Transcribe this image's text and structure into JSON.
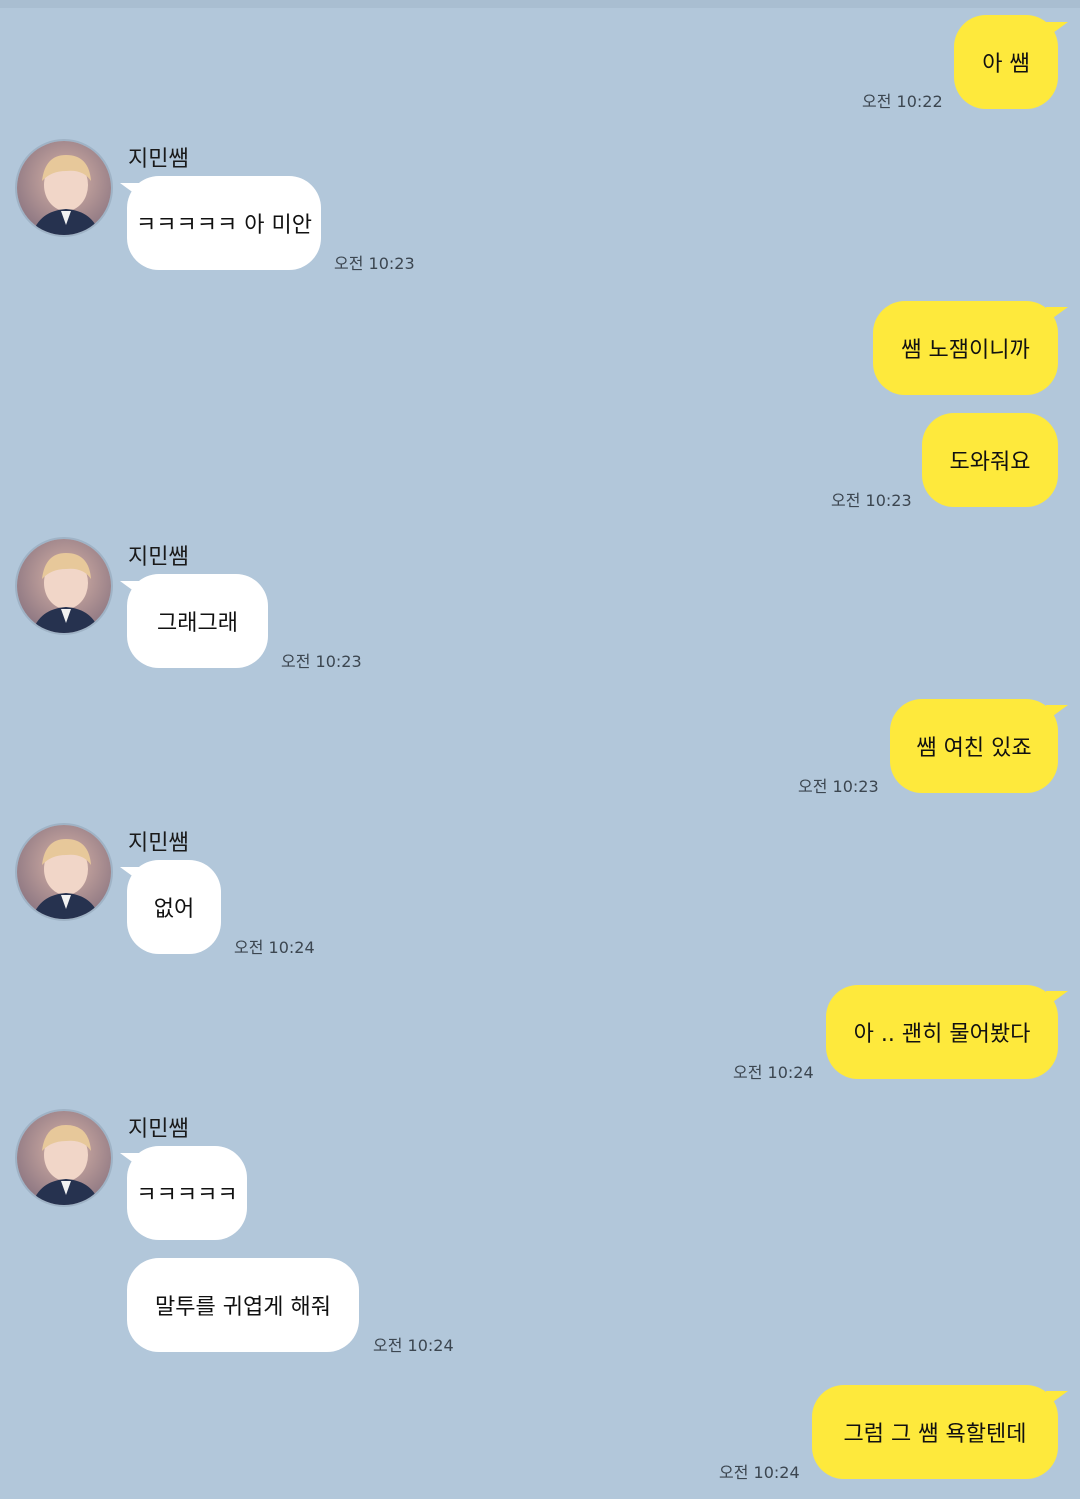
{
  "chat": {
    "colors": {
      "background": "#b2c7da",
      "my_bubble": "#fee93c",
      "other_bubble": "#ffffff"
    },
    "sender_name": "지민쌤",
    "avatar_icon": "profile-photo",
    "messages": [
      {
        "from": "me",
        "text": "아 쌤",
        "time": "오전 10:22"
      },
      {
        "from": "other",
        "text": "ㅋㅋㅋㅋㅋ 아 미안",
        "time": "오전 10:23"
      },
      {
        "from": "me",
        "text": "쌤 노잼이니까"
      },
      {
        "from": "me",
        "text": "도와줘요",
        "time": "오전 10:23"
      },
      {
        "from": "other",
        "text": "그래그래",
        "time": "오전 10:23"
      },
      {
        "from": "me",
        "text": "쌤 여친 있죠",
        "time": "오전 10:23"
      },
      {
        "from": "other",
        "text": "없어",
        "time": "오전 10:24"
      },
      {
        "from": "me",
        "text": "아 .. 괜히 물어봤다",
        "time": "오전 10:24"
      },
      {
        "from": "other",
        "text": "ㅋㅋㅋㅋㅋ"
      },
      {
        "from": "other",
        "text": "말투를 귀엽게 해줘",
        "time": "오전 10:24"
      },
      {
        "from": "me",
        "text": "그럼 그 쌤 욕할텐데",
        "time": "오전 10:24"
      }
    ]
  }
}
